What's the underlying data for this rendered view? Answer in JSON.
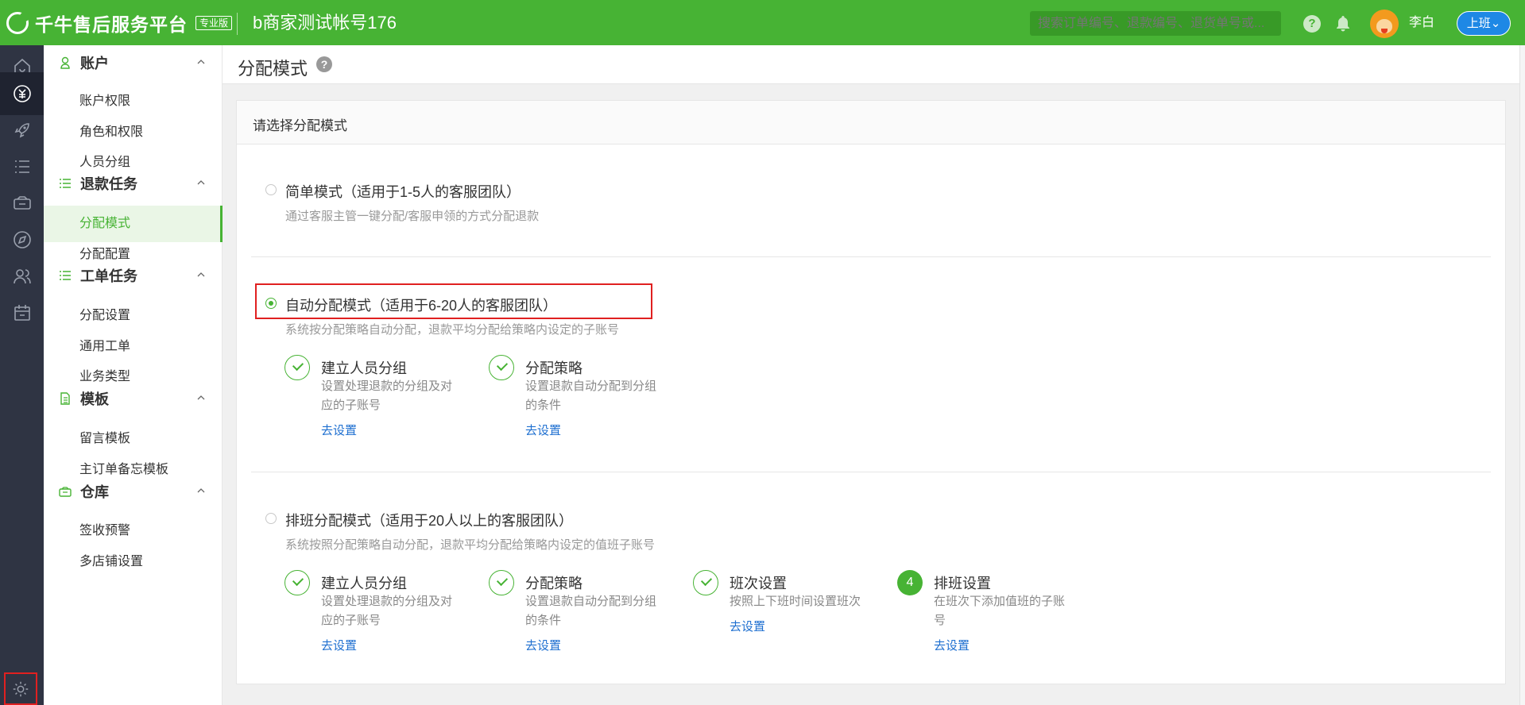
{
  "header": {
    "brand": "千牛售后服务平台",
    "edition": "专业版",
    "account": "b商家测试帐号176",
    "search_placeholder": "搜索订单编号、退款编号、退货单号或...",
    "help": "?",
    "username": "李白",
    "shift_label": "上班"
  },
  "rail": {
    "icons": [
      "home-icon",
      "refund-icon",
      "rocket-icon",
      "task-list-icon",
      "warehouse-icon",
      "compass-icon",
      "users-icon",
      "calendar-icon",
      "gear-icon"
    ]
  },
  "sidebar": {
    "groups": [
      {
        "label": "账户",
        "items": [
          "账户权限",
          "角色和权限",
          "人员分组"
        ]
      },
      {
        "label": "退款任务",
        "items": [
          "分配模式",
          "分配配置"
        ]
      },
      {
        "label": "工单任务",
        "items": [
          "分配设置",
          "通用工单",
          "业务类型"
        ]
      },
      {
        "label": "模板",
        "items": [
          "留言模板",
          "主订单备忘模板"
        ]
      },
      {
        "label": "仓库",
        "items": [
          "签收预警",
          "多店铺设置"
        ]
      }
    ],
    "active_item": "分配模式"
  },
  "page": {
    "title": "分配模式",
    "help": "?",
    "card_title": "请选择分配模式"
  },
  "modes": [
    {
      "title": "简单模式（适用于1-5人的客服团队）",
      "desc": "通过客服主管一键分配/客服申领的方式分配退款",
      "selected": false
    },
    {
      "title": "自动分配模式（适用于6-20人的客服团队）",
      "desc": "系统按分配策略自动分配，退款平均分配给策略内设定的子账号",
      "selected": true,
      "steps": [
        {
          "title": "建立人员分组",
          "desc": "设置处理退款的分组及对应的子账号",
          "link": "去设置",
          "done": true
        },
        {
          "title": "分配策略",
          "desc": "设置退款自动分配到分组的条件",
          "link": "去设置",
          "done": true
        }
      ]
    },
    {
      "title": "排班分配模式（适用于20人以上的客服团队）",
      "desc": "系统按照分配策略自动分配，退款平均分配给策略内设定的值班子账号",
      "selected": false,
      "steps": [
        {
          "title": "建立人员分组",
          "desc": "设置处理退款的分组及对应的子账号",
          "link": "去设置",
          "done": true
        },
        {
          "title": "分配策略",
          "desc": "设置退款自动分配到分组的条件",
          "link": "去设置",
          "done": true
        },
        {
          "title": "班次设置",
          "desc": "按照上下班时间设置班次",
          "link": "去设置",
          "done": true
        },
        {
          "title": "排班设置",
          "desc": "在班次下添加值班的子账号",
          "link": "去设置",
          "done": false,
          "number": "4"
        }
      ]
    }
  ],
  "colors": {
    "brand_green": "#47b334",
    "rail_bg": "#2f3443",
    "link_blue": "#1e6fd0",
    "highlight_red": "#e02020"
  }
}
